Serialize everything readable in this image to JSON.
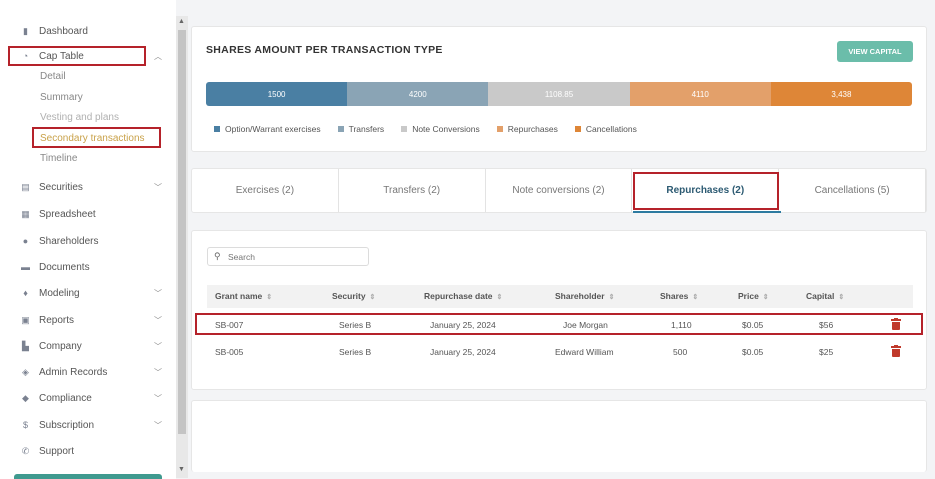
{
  "sidebar": {
    "items": [
      {
        "label": "Dashboard",
        "icon": "dashboard-icon"
      },
      {
        "label": "Cap Table",
        "icon": "pie-chart-icon",
        "chevron": "up"
      },
      {
        "label": "Securities",
        "icon": "securities-icon",
        "chevron": "down"
      },
      {
        "label": "Spreadsheet",
        "icon": "spreadsheet-icon"
      },
      {
        "label": "Shareholders",
        "icon": "user-icon"
      },
      {
        "label": "Documents",
        "icon": "folder-icon"
      },
      {
        "label": "Modeling",
        "icon": "lightbulb-icon",
        "chevron": "down"
      },
      {
        "label": "Reports",
        "icon": "report-icon",
        "chevron": "down"
      },
      {
        "label": "Company",
        "icon": "building-icon",
        "chevron": "down"
      },
      {
        "label": "Admin Records",
        "icon": "admin-icon",
        "chevron": "down"
      },
      {
        "label": "Compliance",
        "icon": "shield-icon",
        "chevron": "down"
      },
      {
        "label": "Subscription",
        "icon": "dollar-icon",
        "chevron": "down"
      },
      {
        "label": "Support",
        "icon": "support-icon"
      }
    ],
    "cap_table_sub": [
      "Detail",
      "Summary",
      "Vesting and plans",
      "Secondary transactions",
      "Timeline"
    ]
  },
  "shares_card": {
    "title": "SHARES AMOUNT PER TRANSACTION TYPE",
    "view_capital_label": "VIEW CAPITAL",
    "segments": [
      {
        "label": "1500",
        "color": "#4a7fa3"
      },
      {
        "label": "4200",
        "color": "#8aa4b5"
      },
      {
        "label": "1108.85",
        "color": "#c9c9c9"
      },
      {
        "label": "4110",
        "color": "#e3a06a"
      },
      {
        "label": "3,438",
        "color": "#de8637"
      }
    ],
    "legend": [
      {
        "label": "Option/Warrant exercises",
        "color": "#4a7fa3"
      },
      {
        "label": "Transfers",
        "color": "#8aa4b5"
      },
      {
        "label": "Note Conversions",
        "color": "#c9c9c9"
      },
      {
        "label": "Repurchases",
        "color": "#e3a06a"
      },
      {
        "label": "Cancellations",
        "color": "#de8637"
      }
    ]
  },
  "tabs": [
    {
      "label": "Exercises (2)"
    },
    {
      "label": "Transfers (2)"
    },
    {
      "label": "Note conversions (2)"
    },
    {
      "label": "Repurchases (2)"
    },
    {
      "label": "Cancellations (5)"
    }
  ],
  "active_tab_index": 3,
  "search": {
    "placeholder": "Search",
    "value": ""
  },
  "table": {
    "columns": [
      "Grant name",
      "Security",
      "Repurchase date",
      "Shareholder",
      "Shares",
      "Price",
      "Capital"
    ],
    "rows": [
      {
        "grant_name": "SB-007",
        "security": "Series B",
        "date": "January 25, 2024",
        "shareholder": "Joe Morgan",
        "shares": "1,110",
        "price": "$0.05",
        "capital": "$56"
      },
      {
        "grant_name": "SB-005",
        "security": "Series B",
        "date": "January 25, 2024",
        "shareholder": "Edward William",
        "shares": "500",
        "price": "$0.05",
        "capital": "$25"
      }
    ]
  },
  "colors": {
    "accent": "#6bbdaa",
    "highlight": "#b5222a",
    "delete": "#c0392b",
    "active_tab": "#2c5a72"
  }
}
